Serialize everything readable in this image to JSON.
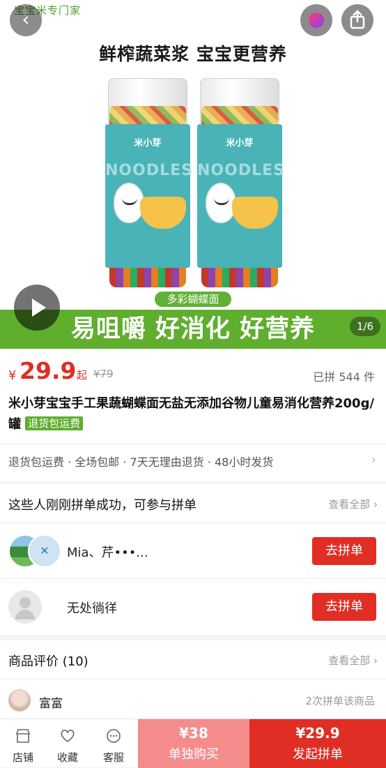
{
  "hero": {
    "top_brand": "宝宝米专门家",
    "headline": "鲜榨蔬菜浆 宝宝更营养",
    "jar_brand": "米小芽",
    "jar_noodles": "NOODLES",
    "pill": "多彩蝴蝶面",
    "banner": "易咀嚼 好消化 好营养",
    "page_indicator": "1/6"
  },
  "price": {
    "currency": "¥",
    "amount": "29.9",
    "suffix": "起",
    "original": "¥79",
    "sold": "已拼 544 件"
  },
  "product": {
    "title": "米小芽宝宝手工果蔬蝴蝶面无盐无添加谷物儿童易消化营养200g/罐",
    "tag": "退货包运费"
  },
  "guarantees": {
    "text": "退货包运费 · 全场包邮 · 7天无理由退货 · 48小时发货"
  },
  "group": {
    "header": "这些人刚刚拼单成功，可参与拼单",
    "more": "查看全部",
    "rows": [
      {
        "name": "Mia、芹•••...",
        "join": "去拼单"
      },
      {
        "name": "无处徜徉",
        "join": "去拼单"
      }
    ]
  },
  "reviews": {
    "header": "商品评价 (10)",
    "more": "查看全部",
    "first": {
      "name": "富富",
      "meta": "2次拼单该商品"
    }
  },
  "bottom": {
    "shop": "店铺",
    "favorite": "收藏",
    "service": "客服",
    "single_price": "¥38",
    "single_label": "单独购买",
    "group_price": "¥29.9",
    "group_label": "发起拼单"
  },
  "colors": {
    "accent_red": "#e02e24",
    "accent_green": "#5fae2e",
    "single_buy_bg": "#f58c8c"
  }
}
